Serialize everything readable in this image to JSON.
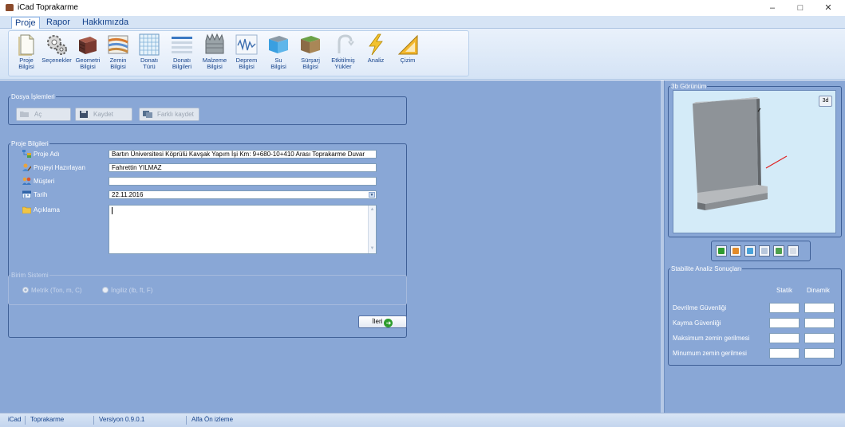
{
  "window": {
    "title": "iCad Toprakarme",
    "controls": {
      "minimize": "–",
      "maximize": "□",
      "close": "✕"
    }
  },
  "menu": {
    "items": [
      {
        "label": "Proje",
        "active": true
      },
      {
        "label": "Rapor",
        "active": false
      },
      {
        "label": "Hakkımızda",
        "active": false
      }
    ]
  },
  "ribbon": {
    "buttons": [
      {
        "label": "Proje\nBilgisi",
        "icon": "document-icon"
      },
      {
        "label": "Seçenekler",
        "icon": "gears-icon"
      },
      {
        "label": "Geometri\nBilgisi",
        "icon": "geometry-icon"
      },
      {
        "label": "Zemin\nBilgisi",
        "icon": "soil-icon"
      },
      {
        "label": "Donatı\nTürü",
        "icon": "rebar-mesh-icon"
      },
      {
        "label": "Donatı\nBilgileri",
        "icon": "rebar-list-icon"
      },
      {
        "label": "Malzeme\nBilgisi",
        "icon": "material-icon"
      },
      {
        "label": "Deprem\nBilgisi",
        "icon": "seismic-wave-icon"
      },
      {
        "label": "Su\nBilgisi",
        "icon": "water-icon"
      },
      {
        "label": "Sürşarj\nBilgisi",
        "icon": "surcharge-icon"
      },
      {
        "label": "Etkitilmiş\nYükler",
        "icon": "load-icon"
      },
      {
        "label": "Analiz",
        "icon": "lightning-icon"
      },
      {
        "label": "Çizim",
        "icon": "drawing-triangle-icon"
      }
    ]
  },
  "file_ops": {
    "legend": "Dosya İşlemleri",
    "open_label": "Aç",
    "save_label": "Kaydet",
    "save_as_label": "Farklı kaydet"
  },
  "project": {
    "legend": "Proje Bilgileri",
    "name_label": "Proje Adı",
    "name_value": "Bartın Üniversitesi Köprülü Kavşak Yapım İşi Km: 9+680-10+410 Arası Toprakarme Duvar",
    "preparer_label": "Projeyi Hazırlayan",
    "preparer_value": "Fahrettin YILMAZ",
    "client_label": "Müşteri",
    "client_value": "",
    "date_label": "Tarih",
    "date_value": "22.11.2016",
    "desc_label": "Açıklama",
    "desc_value": ""
  },
  "units": {
    "legend": "Birim Sistemi",
    "metric_label": "Metrik (Ton, m, C)",
    "imperial_label": "İngiliz (lb, ft, F)"
  },
  "next_label": "İleri",
  "view3d": {
    "legend": "3b Görünüm",
    "button_3d": "3d"
  },
  "stability": {
    "legend": "Stabilite Analiz Sonuçları",
    "col_static": "Statik",
    "col_dynamic": "Dinamik",
    "rows": [
      {
        "label": "Devrilme Güvenliği"
      },
      {
        "label": "Kayma Güvenliği"
      },
      {
        "label": "Maksimum zemin gerilmesi"
      },
      {
        "label": "Minumum zemin gerilmesi"
      }
    ]
  },
  "status": {
    "app": "iCad",
    "module": "Toprakarme",
    "version": "Versiyon 0.9.0.1",
    "stage": "Alfa Ön izleme"
  },
  "colors": {
    "panel_bg": "#89a7d6",
    "accent_text": "#15428b",
    "ribbon_bg": "#dfeaf8"
  }
}
